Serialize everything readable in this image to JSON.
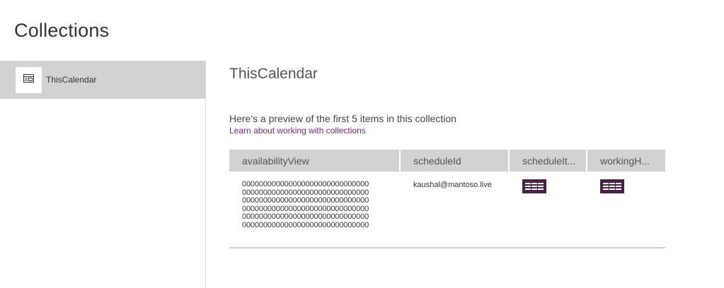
{
  "page": {
    "title": "Collections"
  },
  "sidebar": {
    "items": [
      {
        "label": "ThisCalendar",
        "icon": "collection-icon",
        "selected": true
      }
    ]
  },
  "main": {
    "collection_title": "ThisCalendar",
    "preview_text": "Here's a preview of the first 5 items in this collection",
    "learn_link": "Learn about working with collections",
    "table": {
      "columns": [
        "availabilityView",
        "scheduleId",
        "scheduleIt...",
        "workingH..."
      ],
      "rows": [
        {
          "availabilityView": [
            "000000000000000000000000000000",
            "000000000000000000000000000000",
            "000000000000000000000000000000",
            "000000000000000000000000000000",
            "000000000000000000000000000000",
            "000000000000000000000000000000"
          ],
          "scheduleId": "kaushal@mantoso.live",
          "scheduleItems": "table-icon",
          "workingHours": "table-icon"
        }
      ]
    }
  },
  "colors": {
    "accent": "#742774",
    "table_icon": "#4a2148",
    "header_bg": "#d2d2d2"
  }
}
